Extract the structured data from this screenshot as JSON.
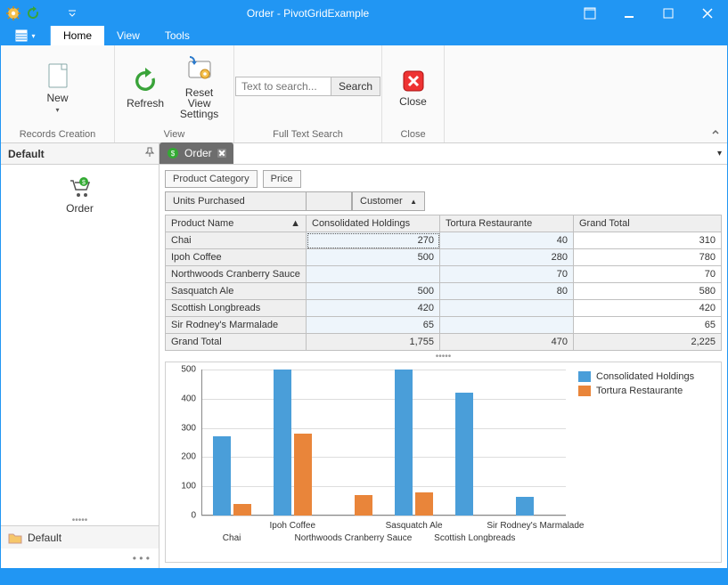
{
  "window": {
    "title": "Order - PivotGridExample"
  },
  "tabs": {
    "home": "Home",
    "view": "View",
    "tools": "Tools"
  },
  "ribbon": {
    "new": "New",
    "records_creation": "Records Creation",
    "refresh": "Refresh",
    "reset_view": "Reset View\nSettings",
    "view_group": "View",
    "search_placeholder": "Text to search...",
    "search_btn": "Search",
    "search_group": "Full Text Search",
    "close": "Close",
    "close_group": "Close"
  },
  "sidebar": {
    "head": "Default",
    "item_order": "Order",
    "footer": "Default"
  },
  "doc_tab": "Order",
  "filters": {
    "product_category": "Product Category",
    "price": "Price"
  },
  "fields": {
    "units_purchased": "Units Purchased",
    "customer": "Customer",
    "product_name": "Product Name"
  },
  "columns": {
    "c1": "Consolidated Holdings",
    "c2": "Tortura Restaurante",
    "gt": "Grand Total"
  },
  "rows": {
    "r0": {
      "name": "Chai",
      "v1": "270",
      "v2": "40",
      "gt": "310"
    },
    "r1": {
      "name": "Ipoh Coffee",
      "v1": "500",
      "v2": "280",
      "gt": "780"
    },
    "r2": {
      "name": "Northwoods Cranberry Sauce",
      "v1": "",
      "v2": "70",
      "gt": "70"
    },
    "r3": {
      "name": "Sasquatch Ale",
      "v1": "500",
      "v2": "80",
      "gt": "580"
    },
    "r4": {
      "name": "Scottish Longbreads",
      "v1": "420",
      "v2": "",
      "gt": "420"
    },
    "r5": {
      "name": "Sir Rodney's Marmalade",
      "v1": "65",
      "v2": "",
      "gt": "65"
    },
    "grand": {
      "name": "Grand Total",
      "v1": "1,755",
      "v2": "470",
      "gt": "2,225"
    }
  },
  "legend": {
    "s1": "Consolidated Holdings",
    "s2": "Tortura Restaurante"
  },
  "colors": {
    "series1": "#4a9ed9",
    "series2": "#e9853a"
  },
  "chart_data": {
    "type": "bar",
    "categories": [
      "Chai",
      "Ipoh Coffee",
      "Northwoods Cranberry Sauce",
      "Sasquatch Ale",
      "Scottish Longbreads",
      "Sir Rodney's Marmalade"
    ],
    "series": [
      {
        "name": "Consolidated Holdings",
        "values": [
          270,
          500,
          0,
          500,
          420,
          65
        ]
      },
      {
        "name": "Tortura Restaurante",
        "values": [
          40,
          280,
          70,
          80,
          0,
          0
        ]
      }
    ],
    "ylim": [
      0,
      500
    ],
    "yticks": [
      0,
      100,
      200,
      300,
      400,
      500
    ],
    "xlabel": "",
    "ylabel": "",
    "title": ""
  }
}
